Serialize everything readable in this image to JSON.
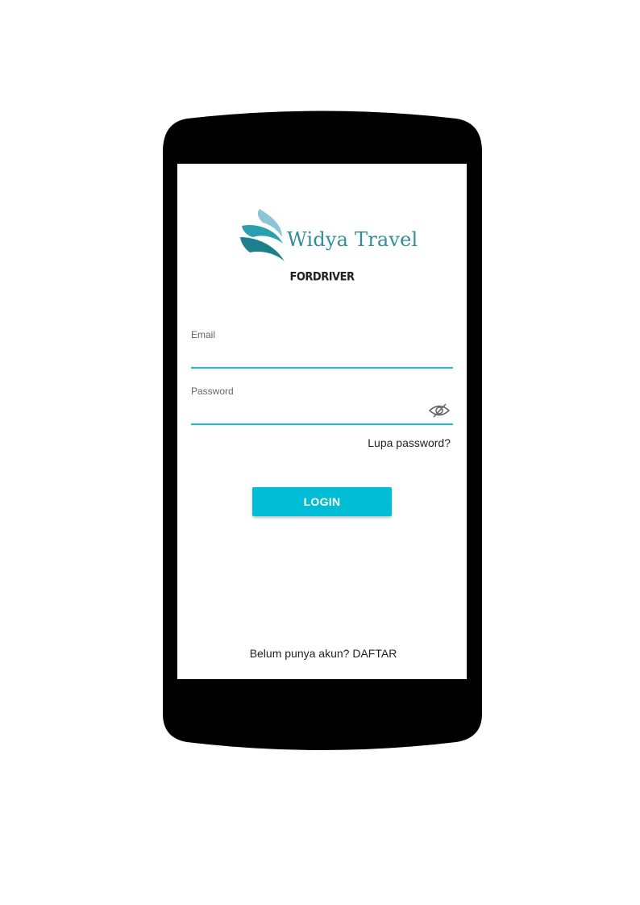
{
  "brand": {
    "name": "Widya Travel",
    "subtitle": "FORDRIVER",
    "logo_icon": "wave-wing-logo-icon",
    "colors": {
      "brand_teal": "#2e8f9c",
      "accent": "#00bcd4",
      "input_underline": "#1ebdd6"
    }
  },
  "form": {
    "email": {
      "label": "Email",
      "value": ""
    },
    "password": {
      "label": "Password",
      "value": "",
      "toggle_icon": "eye-off-icon"
    },
    "forgot_password": "Lupa password?",
    "login_label": "LOGIN"
  },
  "footer": {
    "prompt": "Belum punya akun?",
    "signup_link": "DAFTAR"
  }
}
